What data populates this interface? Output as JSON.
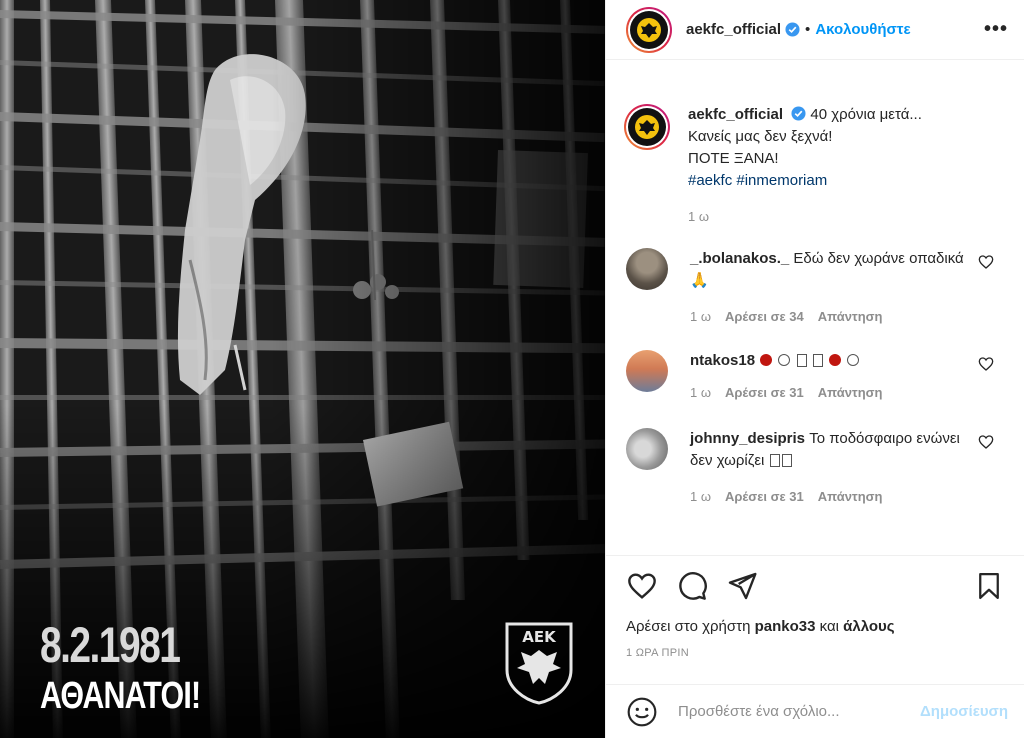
{
  "photo": {
    "date": "8.2.1981",
    "slogan": "ΑΘΑΝΑΤΟΙ!",
    "logo_text": "ΑΕΚ"
  },
  "header": {
    "username": "aekfc_official",
    "separator": "•",
    "follow_label": "Ακολουθήστε",
    "more_icon": "more-horizontal-icon"
  },
  "caption": {
    "username": "aekfc_official",
    "line1": "40 χρόνια μετά...",
    "line2": "Κανείς μας δεν ξεχνά!",
    "line3": "ΠΟΤΕ ΞΑΝΑ!",
    "hashtag1": "#aekfc",
    "hashtag2": "#inmemoriam",
    "time": "1 ω"
  },
  "comments": [
    {
      "username": "_.bolanakos._",
      "text": "Εδώ δεν χωράνε οπαδικά 🙏",
      "time": "1 ω",
      "likes": "Αρέσει σε 34",
      "reply": "Απάντηση"
    },
    {
      "username": "ntakos18",
      "text": "",
      "time": "1 ω",
      "likes": "Αρέσει σε 31",
      "reply": "Απάντηση"
    },
    {
      "username": "johnny_desipris",
      "text": "Το ποδόσφαιρο ενώνει δεν χωρίζει",
      "time": "1 ω",
      "likes": "Αρέσει σε 31",
      "reply": "Απάντηση"
    }
  ],
  "likes_line": {
    "prefix": "Αρέσει στο χρήστη",
    "user": "panko33",
    "and": "και",
    "others": "άλλους"
  },
  "posted_ago": "1 ΩΡΑ ΠΡΙΝ",
  "composer": {
    "placeholder": "Προσθέστε ένα σχόλιο...",
    "post_label": "Δημοσίευση"
  },
  "colors": {
    "accent": "#0095f6",
    "aek_yellow": "#f4c20d",
    "muted": "#8e8e8e",
    "heart_red": "#c0160f"
  }
}
